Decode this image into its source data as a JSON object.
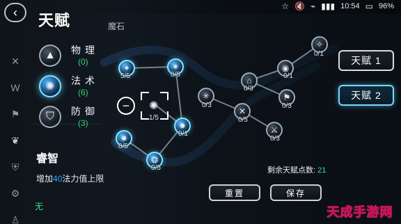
{
  "status": {
    "time": "10:54",
    "battery": "96%",
    "signal_icon": "signal-icon",
    "wifi_icon": "wifi-icon",
    "mute_icon": "mute-icon",
    "star_icon": "star-icon"
  },
  "header": {
    "title": "天赋",
    "subtitle": "魔石"
  },
  "categories": [
    {
      "label": "物理",
      "value": "(0)",
      "active": false,
      "icon": "physical-icon"
    },
    {
      "label": "法术",
      "value": "(6)",
      "active": true,
      "icon": "magic-icon"
    },
    {
      "label": "防御",
      "value": "(3)",
      "active": false,
      "icon": "defense-icon"
    }
  ],
  "selected_skill": {
    "name": "睿智",
    "desc_prefix": "增加",
    "desc_value": "40",
    "desc_suffix": "法力值上限",
    "none_label": "无"
  },
  "nodes": [
    {
      "label": "5/5",
      "state": "blue"
    },
    {
      "label": "0/5",
      "state": "blue"
    },
    {
      "label": "0/5",
      "state": "blue"
    },
    {
      "label": "0/5",
      "state": "blue"
    },
    {
      "label": "0/1",
      "state": "blue"
    },
    {
      "label": "0/3",
      "state": "normal"
    },
    {
      "label": "0/3",
      "state": "normal"
    },
    {
      "label": "0/1",
      "state": "normal"
    },
    {
      "label": "0/1",
      "state": "normal"
    },
    {
      "label": "0/3",
      "state": "normal"
    },
    {
      "label": "0/5",
      "state": "normal"
    },
    {
      "label": "0/3",
      "state": "normal"
    }
  ],
  "selector": {
    "label": "1/5"
  },
  "right_tabs": {
    "tab1": "天赋 1",
    "tab2": "天赋 2"
  },
  "remaining": {
    "label": "剩余天赋点数:",
    "value": "21"
  },
  "actions": {
    "reset": "重置",
    "save": "保存"
  },
  "watermark": "天成手游网"
}
